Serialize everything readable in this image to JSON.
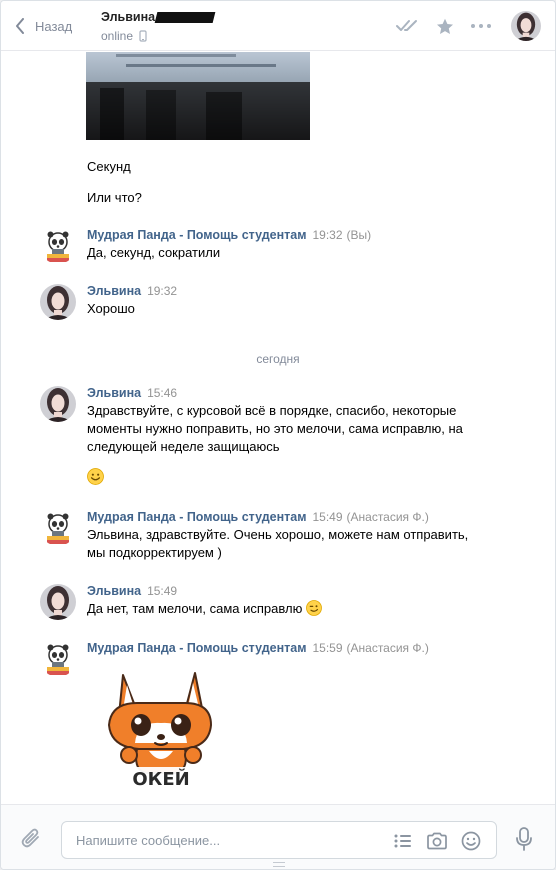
{
  "header": {
    "back_label": "Назад",
    "peer_name": "Эльвина",
    "peer_status": "online"
  },
  "history": {
    "lines": [
      "Секунд",
      "Или что?"
    ],
    "date_separator": "сегодня",
    "messages": [
      {
        "author": "Мудрая Панда - Помощь студентам",
        "time": "19:32",
        "tail": "(Вы)",
        "text": "Да, секунд, сократили"
      },
      {
        "author": "Эльвина",
        "time": "19:32",
        "text": "Хорошо"
      },
      {
        "author": "Эльвина",
        "time": "15:46",
        "text": "Здравствуйте, с курсовой всё в порядке, спасибо, некоторые моменты нужно поправить, но это мелочи, сама исправлю, на следующей неделе защищаюсь"
      },
      {
        "author": "Мудрая Панда - Помощь студентам",
        "time": "15:49",
        "tail": "(Анастасия Ф.)",
        "text": "Эльвина, здравствуйте. Очень хорошо, можете нам отправить, мы подкорректируем )"
      },
      {
        "author": "Эльвина",
        "time": "15:49",
        "text": "Да нет, там мелочи, сама исправлю"
      },
      {
        "author": "Мудрая Панда - Помощь студентам",
        "time": "15:59",
        "tail": "(Анастасия Ф.)",
        "sticker_text": "ОКЕЙ"
      }
    ]
  },
  "composer": {
    "placeholder": "Напишите сообщение..."
  },
  "colors": {
    "author": "#42648b",
    "muted": "#828a99",
    "accent": "#5181b8"
  },
  "icons": [
    "chevron-left-icon",
    "phone-icon",
    "double-check-icon",
    "star-icon",
    "more-icon",
    "paperclip-icon",
    "template-list-icon",
    "camera-icon",
    "smile-icon",
    "microphone-icon"
  ]
}
